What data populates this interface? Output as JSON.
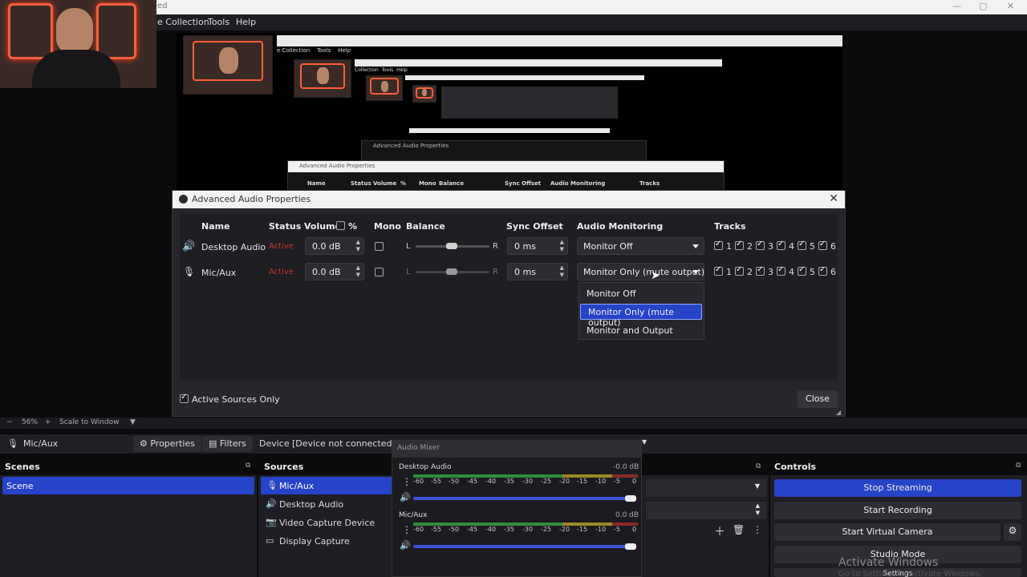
{
  "window": {
    "title_fragment": "ed"
  },
  "menu": {
    "items": [
      "e Collection",
      "Tools",
      "Help"
    ]
  },
  "nested_preview": {
    "menu_items_a": [
      "e Collection",
      "Tools",
      "Help"
    ],
    "menu_items_b": [
      "Collection",
      "Tools",
      "Help"
    ],
    "dialog_title": "Advanced Audio Properties",
    "headers": [
      "Name",
      "Status",
      "Volume",
      "%",
      "Mono",
      "Balance",
      "Sync Offset",
      "Audio Monitoring",
      "Tracks"
    ]
  },
  "dialog": {
    "title": "Advanced Audio Properties",
    "headers": {
      "name": "Name",
      "status": "Status",
      "volume": "Volume",
      "percent": "%",
      "mono": "Mono",
      "balance": "Balance",
      "sync": "Sync Offset",
      "monitoring": "Audio Monitoring",
      "tracks": "Tracks"
    },
    "rows": [
      {
        "name": "Desktop Audio",
        "status": "Active",
        "volume": "0.0 dB",
        "bal_left": "L",
        "bal_right": "R",
        "sync": "0 ms",
        "monitoring": "Monitor Off"
      },
      {
        "name": "Mic/Aux",
        "status": "Active",
        "volume": "0.0 dB",
        "bal_left": "L",
        "bal_right": "R",
        "sync": "0 ms",
        "monitoring": "Monitor Only (mute output)"
      }
    ],
    "tracks": [
      "1",
      "2",
      "3",
      "4",
      "5",
      "6"
    ],
    "dropdown_options": [
      "Monitor Off",
      "Monitor Only (mute output)",
      "Monitor and Output"
    ],
    "active_only_label": "Active Sources Only",
    "close_label": "Close"
  },
  "zoombar": {
    "minus": "−",
    "zoom": "56%",
    "plus": "+",
    "scale": "Scale to Window"
  },
  "propbar": {
    "source": "Mic/Aux",
    "properties": "Properties",
    "filters": "Filters",
    "device_label": "Device",
    "device_value": "[Device not connected or no"
  },
  "docks": {
    "scenes_title": "Scenes",
    "scenes": [
      "Scene"
    ],
    "sources_title": "Sources",
    "sources": [
      "Mic/Aux",
      "Desktop Audio",
      "Video Capture Device",
      "Display Capture"
    ],
    "controls_title": "Controls",
    "controls": [
      "Stop Streaming",
      "Start Recording",
      "Start Virtual Camera",
      "Studio Mode",
      "Settings"
    ]
  },
  "mixer": {
    "title": "Audio Mixer",
    "channels": [
      {
        "name": "Desktop Audio",
        "db": "-0.0 dB"
      },
      {
        "name": "Mic/Aux",
        "db": "0.0 dB"
      }
    ],
    "scale": [
      "-60",
      "-55",
      "-50",
      "-45",
      "-40",
      "-35",
      "-30",
      "-25",
      "-20",
      "-15",
      "-10",
      "-5",
      "0"
    ]
  },
  "watermark": {
    "line1": "Activate Windows",
    "line2": "Go to Settings to activate Windows."
  },
  "colors": {
    "accent": "#2743c7",
    "active_status": "#c0392b"
  }
}
